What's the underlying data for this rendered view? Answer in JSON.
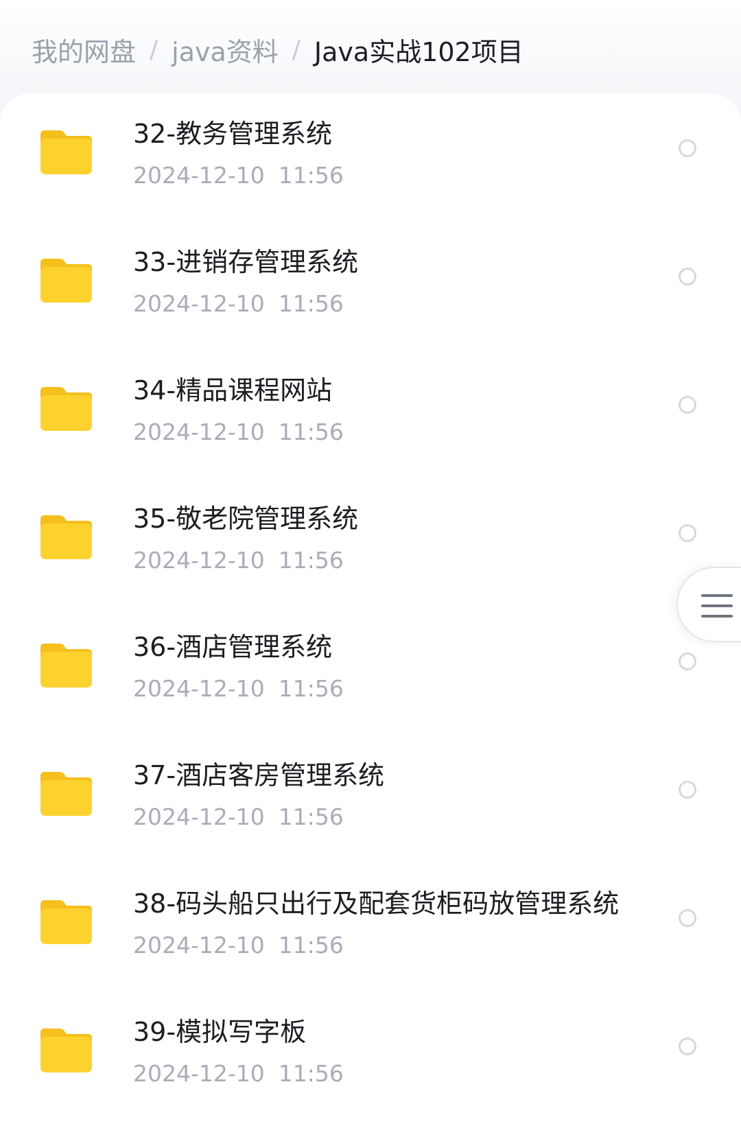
{
  "breadcrumb": {
    "items": [
      {
        "label": "我的网盘"
      },
      {
        "label": "java资料"
      },
      {
        "label": "Java实战102项目"
      }
    ],
    "separator": "/"
  },
  "files": [
    {
      "name": "32-教务管理系统",
      "date": "2024-12-10",
      "time": "11:56",
      "icon": "folder-icon"
    },
    {
      "name": "33-进销存管理系统",
      "date": "2024-12-10",
      "time": "11:56",
      "icon": "folder-icon"
    },
    {
      "name": "34-精品课程网站",
      "date": "2024-12-10",
      "time": "11:56",
      "icon": "folder-icon"
    },
    {
      "name": "35-敬老院管理系统",
      "date": "2024-12-10",
      "time": "11:56",
      "icon": "folder-icon"
    },
    {
      "name": "36-酒店管理系统",
      "date": "2024-12-10",
      "time": "11:56",
      "icon": "folder-icon"
    },
    {
      "name": "37-酒店客房管理系统",
      "date": "2024-12-10",
      "time": "11:56",
      "icon": "folder-icon"
    },
    {
      "name": "38-码头船只出行及配套货柜码放管理系统",
      "date": "2024-12-10",
      "time": "11:56",
      "icon": "folder-icon"
    },
    {
      "name": "39-模拟写字板",
      "date": "2024-12-10",
      "time": "11:56",
      "icon": "folder-icon"
    }
  ],
  "colors": {
    "folder": "#fdd22f",
    "folder_tab": "#f5bf1c",
    "text_primary": "#1b1d22",
    "text_secondary": "#a8adb6",
    "breadcrumb_inactive": "#9aa1ad"
  },
  "floating_menu": {
    "icon": "menu-icon"
  }
}
